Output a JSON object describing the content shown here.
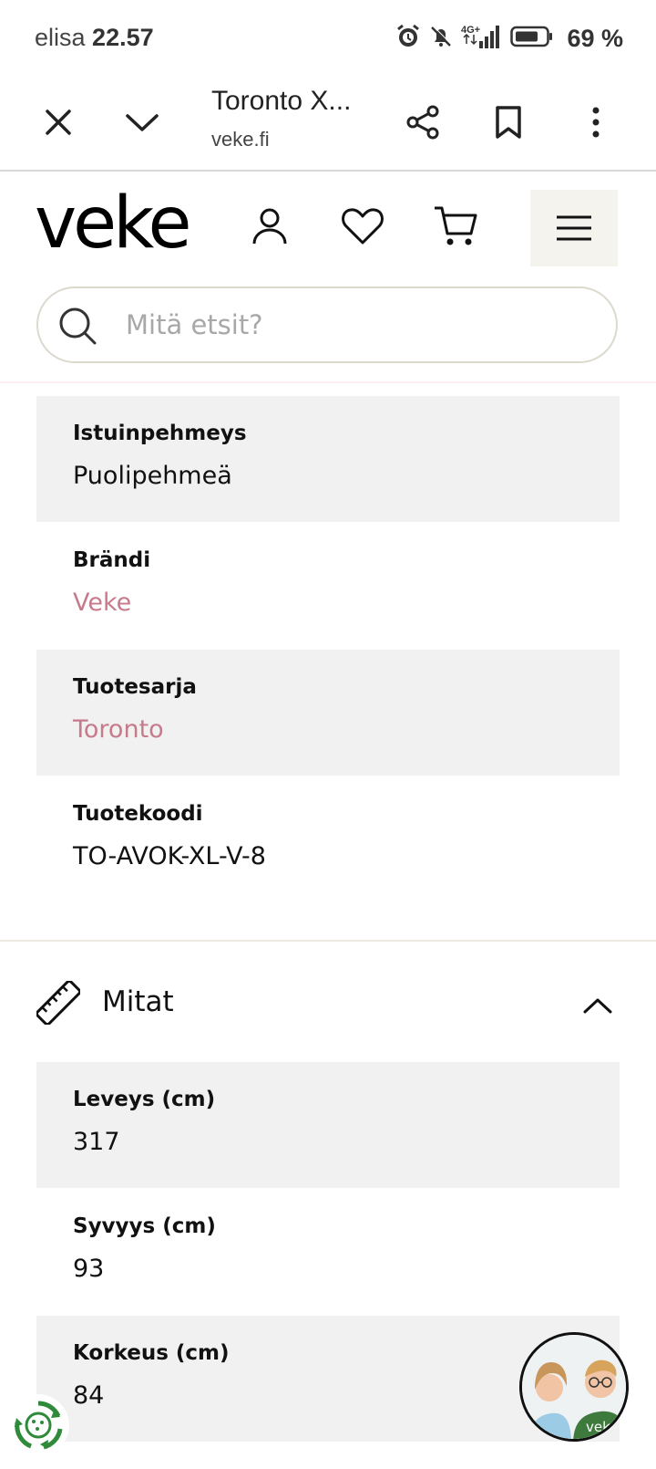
{
  "status_bar": {
    "carrier": "elisa",
    "time": "22.57",
    "network": "4G+",
    "battery": "69 %",
    "battery_level": 0.69
  },
  "browser": {
    "title": "Toronto X...",
    "url": "veke.fi"
  },
  "site": {
    "logo": "veke",
    "search_placeholder": "Mitä etsit?"
  },
  "details": [
    {
      "label": "Istuinpehmeys",
      "value": "Puolipehmeä",
      "link": false
    },
    {
      "label": "Brändi",
      "value": "Veke",
      "link": true
    },
    {
      "label": "Tuotesarja",
      "value": "Toronto",
      "link": true
    },
    {
      "label": "Tuotekoodi",
      "value": "TO-AVOK-XL-V-8",
      "link": false
    }
  ],
  "dimensions": {
    "title": "Mitat",
    "rows": [
      {
        "label": "Leveys (cm)",
        "value": "317"
      },
      {
        "label": "Syvyys (cm)",
        "value": "93"
      },
      {
        "label": "Korkeus (cm)",
        "value": "84"
      }
    ]
  },
  "chat_widget": {
    "brand": "veke"
  },
  "colors": {
    "link": "#c77a8b",
    "row_shade": "#f1f1f1",
    "menu_bg": "#f4f3ee"
  }
}
